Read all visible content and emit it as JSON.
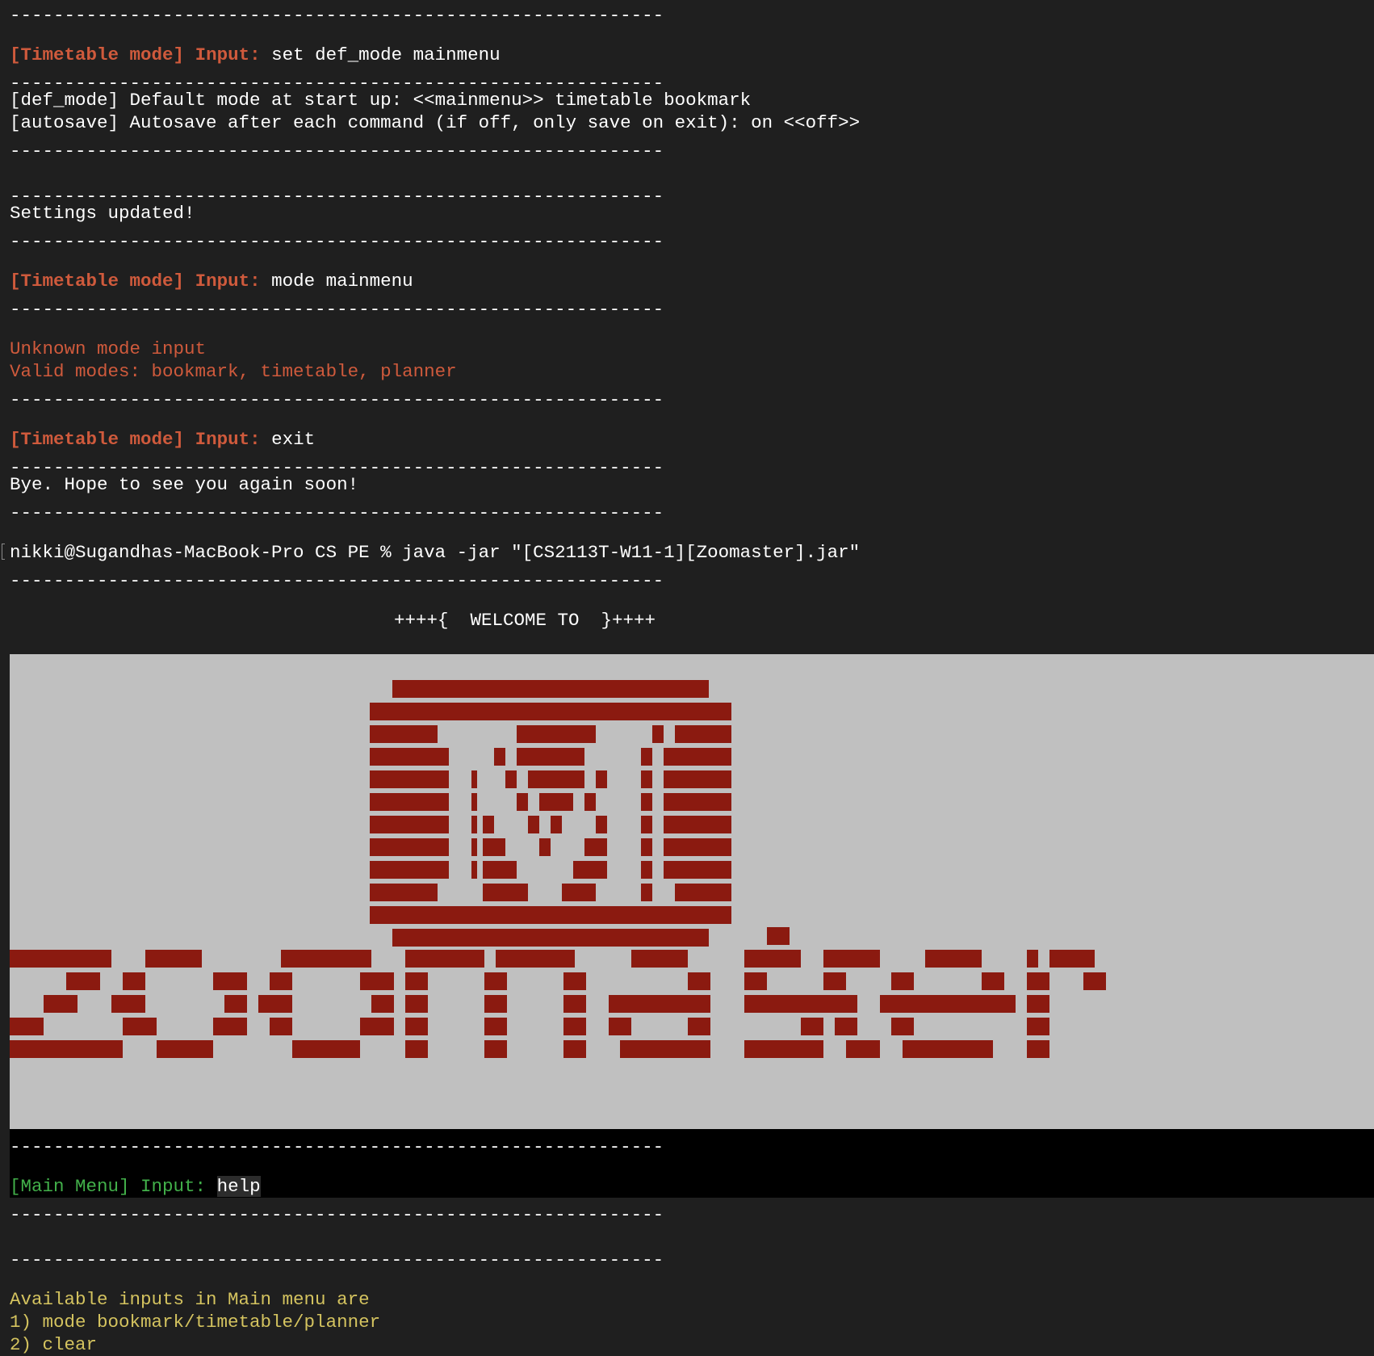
{
  "terminal": {
    "separator": "------------------------------------------------------------",
    "cmd1": {
      "mode_label": "[Timetable mode]",
      "input_label": "Input:",
      "command": "set def_mode mainmenu"
    },
    "settings": {
      "def_mode": "[def_mode] Default mode at start up: <<mainmenu>> timetable bookmark",
      "autosave": "[autosave] Autosave after each command (if off, only save on exit): on <<off>>"
    },
    "settings_updated": "Settings updated!",
    "cmd2": {
      "mode_label": "[Timetable mode]",
      "input_label": "Input:",
      "command": "mode mainmenu"
    },
    "error": {
      "line1": "Unknown mode input",
      "line2": "Valid modes: bookmark, timetable, planner"
    },
    "cmd3": {
      "mode_label": "[Timetable mode]",
      "input_label": "Input:",
      "command": "exit"
    },
    "bye": "Bye. Hope to see you again soon!",
    "shell_prompt": "nikki@Sugandhas-MacBook-Pro CS PE % java -jar \"[CS2113T-W11-1][Zoomaster].jar\"",
    "welcome": "++++{  WELCOME TO  }++++",
    "logo": {
      "name": "zoomaster",
      "icon": "camera-monitor-icon",
      "block_color": "#8b1a10",
      "panel_color": "#c0c0c0"
    },
    "main_prompt": {
      "mode_label": "[Main Menu]",
      "input_label": "Input:",
      "command": "help"
    },
    "help": {
      "heading": "Available inputs in Main menu are",
      "item1": "1) mode bookmark/timetable/planner",
      "item2": "2) clear"
    }
  },
  "colors": {
    "background": "#1f1f1f",
    "orange": "#cf5a3c",
    "green": "#42b04a",
    "yellow": "#d4c35f",
    "white": "#ffffff"
  }
}
